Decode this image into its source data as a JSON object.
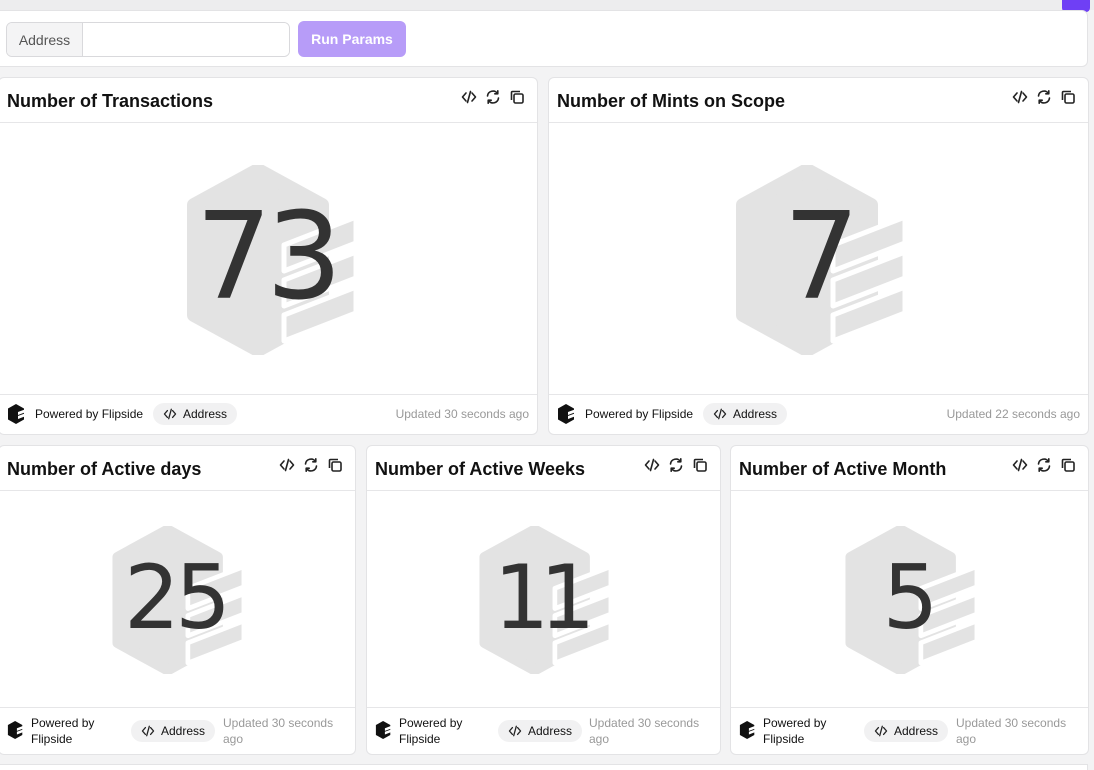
{
  "params": {
    "address_label": "Address",
    "address_value": "",
    "run_label": "Run Params"
  },
  "cards": [
    {
      "title": "Number of Transactions",
      "value": "73",
      "powered": "Powered by Flipside",
      "param_pill": "Address",
      "updated": "Updated 30 seconds ago"
    },
    {
      "title": "Number of Mints on Scope",
      "value": "7",
      "powered": "Powered by Flipside",
      "param_pill": "Address",
      "updated": "Updated 22 seconds ago"
    },
    {
      "title": "Number of Active days",
      "value": "25",
      "powered": "Powered by Flipside",
      "param_pill": "Address",
      "updated": "Updated 30 seconds ago"
    },
    {
      "title": "Number of Active Weeks",
      "value": "11",
      "powered": "Powered by Flipside",
      "param_pill": "Address",
      "updated": "Updated 30 seconds ago"
    },
    {
      "title": "Number of Active Month",
      "value": "5",
      "powered": "Powered by Flipside",
      "param_pill": "Address",
      "updated": "Updated 30 seconds ago"
    }
  ],
  "icons": {
    "card_actions": [
      "code-icon",
      "refresh-icon",
      "copy-icon"
    ],
    "footer_logo": "flipside-logo-icon",
    "pill_icon": "code-icon"
  },
  "colors": {
    "accent": "#6f3ff5",
    "run_button": "#b79cf8",
    "number": "#333333",
    "watermark": "#e3e3e3",
    "muted_text": "#999999"
  }
}
